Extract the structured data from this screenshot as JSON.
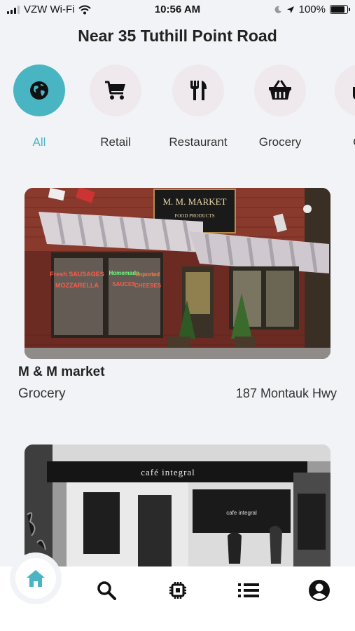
{
  "status_bar": {
    "carrier": "VZW Wi-Fi",
    "time": "10:56 AM",
    "battery": "100%",
    "battery_level": 1.0,
    "icons": [
      "signal-icon",
      "wifi-icon",
      "moon-icon",
      "location-arrow-icon",
      "battery-icon"
    ]
  },
  "header": {
    "title": "Near 35 Tuthill Point Road"
  },
  "categories": [
    {
      "label": "All",
      "icon": "globe-icon",
      "active": true
    },
    {
      "label": "Retail",
      "icon": "cart-icon",
      "active": false
    },
    {
      "label": "Restaurant",
      "icon": "utensils-icon",
      "active": false
    },
    {
      "label": "Grocery",
      "icon": "basket-icon",
      "active": false
    },
    {
      "label": "Co",
      "icon": "coffee-icon",
      "active": false
    }
  ],
  "listings": [
    {
      "name": "M & M market",
      "category": "Grocery",
      "address": "187 Montauk Hwy",
      "photo": {
        "sign": "M. M. MARKET",
        "sign_sub": "FOOD PRODUCTS",
        "neon_left_1": "Fresh SAUSAGES",
        "neon_left_2": "MOZZARELLA",
        "neon_mid_1": "Homemade",
        "neon_mid_2": "SAUCES",
        "neon_right_1": "Imported",
        "neon_right_2": "CHEESES"
      }
    },
    {
      "name": "",
      "category": "",
      "address": "",
      "photo": {
        "sign": "café integral",
        "window_text": "cafe integral"
      }
    }
  ],
  "bottom_nav": [
    {
      "name": "home",
      "icon": "home-icon",
      "active": true
    },
    {
      "name": "search",
      "icon": "search-icon",
      "active": false
    },
    {
      "name": "chip",
      "icon": "chip-icon",
      "active": false
    },
    {
      "name": "list",
      "icon": "list-icon",
      "active": false
    },
    {
      "name": "profile",
      "icon": "account-icon",
      "active": false
    }
  ],
  "colors": {
    "accent": "#4ab5c2",
    "background": "#f2f3f6",
    "category_bg": "#efe9ee"
  }
}
